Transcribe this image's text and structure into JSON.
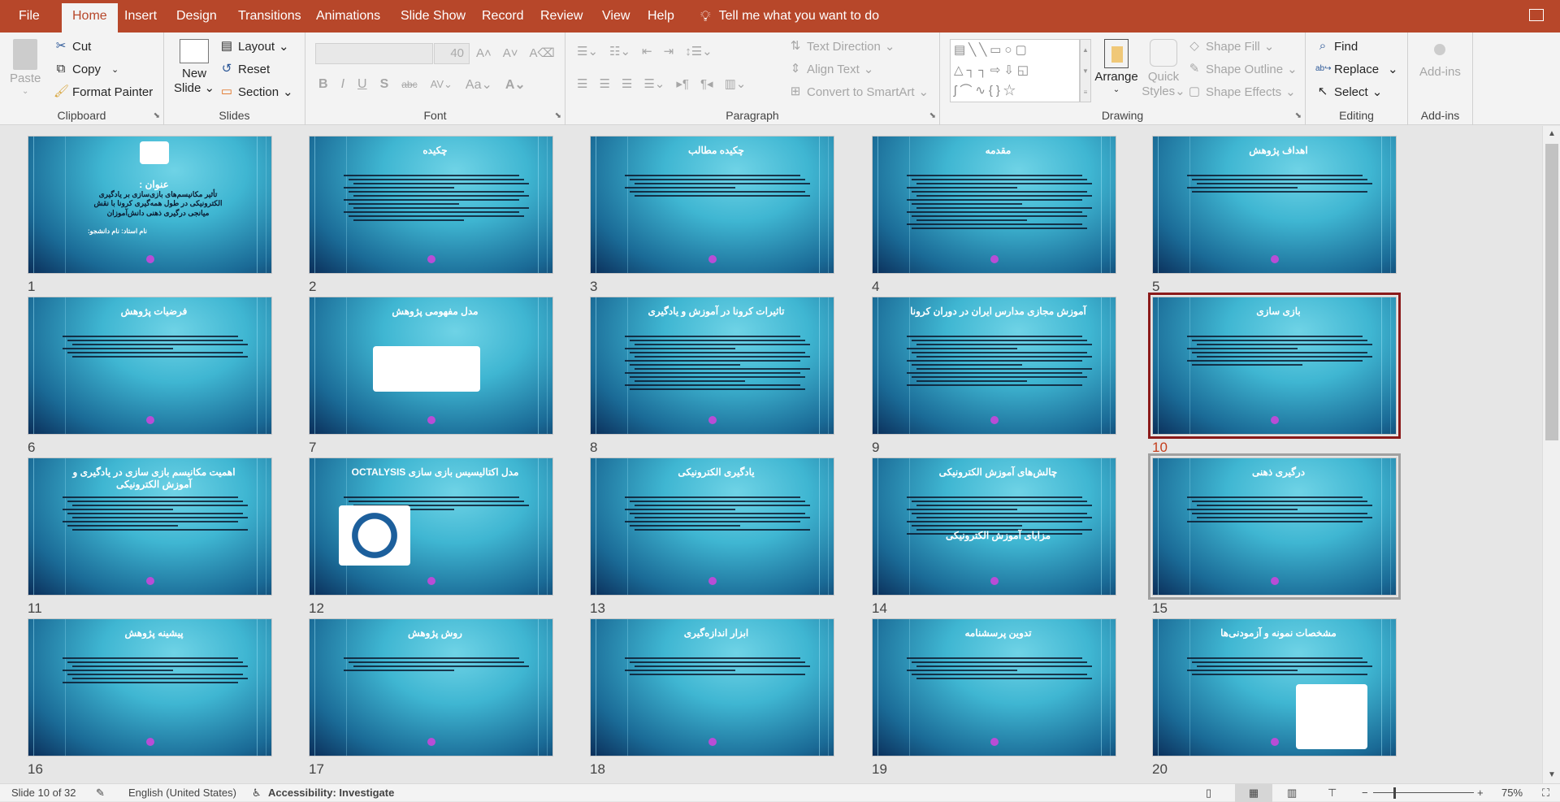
{
  "tabs": [
    "File",
    "Home",
    "Insert",
    "Design",
    "Transitions",
    "Animations",
    "Slide Show",
    "Record",
    "Review",
    "View",
    "Help"
  ],
  "active_tab": "Home",
  "tell_me": "Tell me what you want to do",
  "ribbon": {
    "clipboard": {
      "label": "Clipboard",
      "paste": "Paste",
      "cut": "Cut",
      "copy": "Copy",
      "format_painter": "Format Painter"
    },
    "slides": {
      "label": "Slides",
      "new_slide_1": "New",
      "new_slide_2": "Slide",
      "layout": "Layout",
      "reset": "Reset",
      "section": "Section"
    },
    "font": {
      "label": "Font",
      "font_name": "",
      "font_size": "40"
    },
    "paragraph": {
      "label": "Paragraph",
      "text_direction": "Text Direction",
      "align_text": "Align Text",
      "smartart": "Convert to SmartArt"
    },
    "drawing": {
      "label": "Drawing",
      "arrange": "Arrange",
      "quick_styles_1": "Quick",
      "quick_styles_2": "Styles",
      "shape_fill": "Shape Fill",
      "shape_outline": "Shape Outline",
      "shape_effects": "Shape Effects"
    },
    "editing": {
      "label": "Editing",
      "find": "Find",
      "replace": "Replace",
      "select": "Select"
    },
    "addins": {
      "label": "Add-ins",
      "addins": "Add-ins"
    }
  },
  "slides": [
    {
      "number": "1",
      "title": "عنوان :",
      "subtitle": "تأثیر مکانیسم‌های بازی‌سازی بر یادگیری الکترونیکی در طول همه‌گیری کرونا با نقش میانجی درگیری ذهنی دانش‌آموزان",
      "extra": "نام استاد:   نام دانشجو:"
    },
    {
      "number": "2",
      "title": "چکیده"
    },
    {
      "number": "3",
      "title": "چکیده مطالب"
    },
    {
      "number": "4",
      "title": "مقدمه"
    },
    {
      "number": "5",
      "title": "اهداف پژوهش"
    },
    {
      "number": "6",
      "title": "فرضیات پژوهش"
    },
    {
      "number": "7",
      "title": "مدل مفهومی پژوهش"
    },
    {
      "number": "8",
      "title": "تاثیرات کرونا در آموزش و یادگیری"
    },
    {
      "number": "9",
      "title": "آموزش مجازی مدارس ایران در دوران کرونا"
    },
    {
      "number": "10",
      "title": "بازی سازی"
    },
    {
      "number": "11",
      "title": "اهمیت مکانیسم بازی سازی در یادگیری و آموزش الکترونیکی"
    },
    {
      "number": "12",
      "title": "مدل اکتالیسیس بازی سازی OCTALYSIS"
    },
    {
      "number": "13",
      "title": "یادگیری الکترونیکی"
    },
    {
      "number": "14",
      "title": "چالش‌های آموزش الکترونیکی",
      "extra": "مزایای آموزش الکترونیکی"
    },
    {
      "number": "15",
      "title": "درگیری ذهنی"
    },
    {
      "number": "16",
      "title": "پیشینه پژوهش"
    },
    {
      "number": "17",
      "title": "روش پژوهش"
    },
    {
      "number": "18",
      "title": "ابزار اندازه‌گیری"
    },
    {
      "number": "19",
      "title": "تدوین پرسشنامه"
    },
    {
      "number": "20",
      "title": "مشخصات نمونه و آزمودنی‌ها"
    }
  ],
  "selected_slide": "10",
  "status": {
    "slide": "Slide 10 of 32",
    "language": "English (United States)",
    "accessibility": "Accessibility: Investigate",
    "zoom": "75%",
    "zoom_percent": 75
  },
  "colors": {
    "accent": "#b7472a",
    "selected_border": "#8b1a1a"
  }
}
